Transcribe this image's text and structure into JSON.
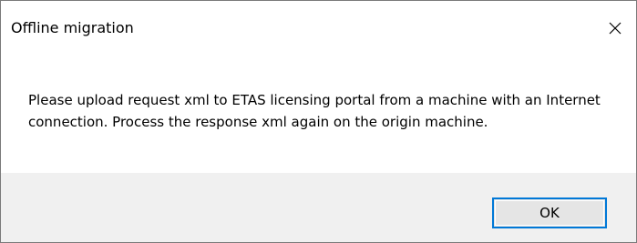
{
  "dialog": {
    "title": "Offline migration",
    "message": "Please upload request xml to ETAS licensing portal from a machine with an Internet connection. Process the response xml again on the origin machine.",
    "ok_label": "OK",
    "close_icon": "close-icon"
  },
  "colors": {
    "footer_background": "#f0f0f0",
    "button_focus_border": "#0078d7",
    "button_background": "#e5e5e5"
  }
}
